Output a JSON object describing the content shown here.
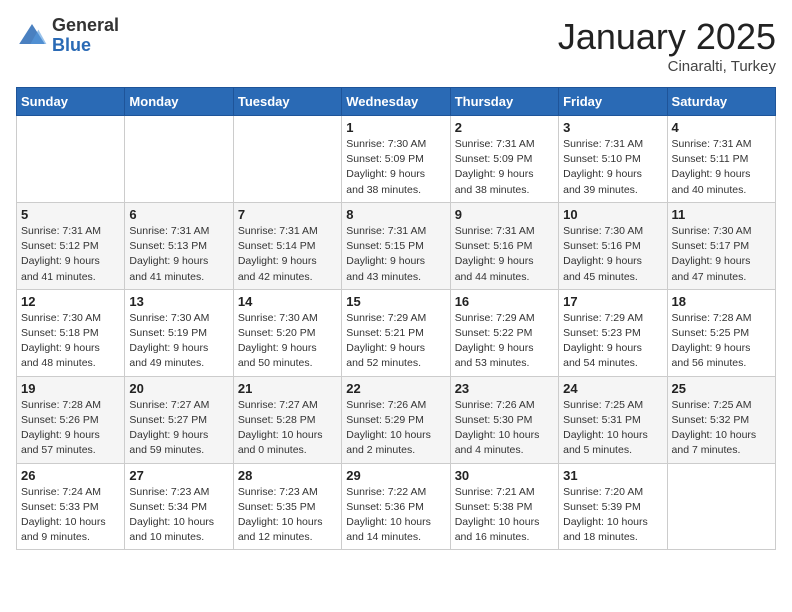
{
  "logo": {
    "general": "General",
    "blue": "Blue"
  },
  "header": {
    "month": "January 2025",
    "location": "Cinaralti, Turkey"
  },
  "weekdays": [
    "Sunday",
    "Monday",
    "Tuesday",
    "Wednesday",
    "Thursday",
    "Friday",
    "Saturday"
  ],
  "weeks": [
    [
      {
        "day": "",
        "info": ""
      },
      {
        "day": "",
        "info": ""
      },
      {
        "day": "",
        "info": ""
      },
      {
        "day": "1",
        "info": "Sunrise: 7:30 AM\nSunset: 5:09 PM\nDaylight: 9 hours\nand 38 minutes."
      },
      {
        "day": "2",
        "info": "Sunrise: 7:31 AM\nSunset: 5:09 PM\nDaylight: 9 hours\nand 38 minutes."
      },
      {
        "day": "3",
        "info": "Sunrise: 7:31 AM\nSunset: 5:10 PM\nDaylight: 9 hours\nand 39 minutes."
      },
      {
        "day": "4",
        "info": "Sunrise: 7:31 AM\nSunset: 5:11 PM\nDaylight: 9 hours\nand 40 minutes."
      }
    ],
    [
      {
        "day": "5",
        "info": "Sunrise: 7:31 AM\nSunset: 5:12 PM\nDaylight: 9 hours\nand 41 minutes."
      },
      {
        "day": "6",
        "info": "Sunrise: 7:31 AM\nSunset: 5:13 PM\nDaylight: 9 hours\nand 41 minutes."
      },
      {
        "day": "7",
        "info": "Sunrise: 7:31 AM\nSunset: 5:14 PM\nDaylight: 9 hours\nand 42 minutes."
      },
      {
        "day": "8",
        "info": "Sunrise: 7:31 AM\nSunset: 5:15 PM\nDaylight: 9 hours\nand 43 minutes."
      },
      {
        "day": "9",
        "info": "Sunrise: 7:31 AM\nSunset: 5:16 PM\nDaylight: 9 hours\nand 44 minutes."
      },
      {
        "day": "10",
        "info": "Sunrise: 7:30 AM\nSunset: 5:16 PM\nDaylight: 9 hours\nand 45 minutes."
      },
      {
        "day": "11",
        "info": "Sunrise: 7:30 AM\nSunset: 5:17 PM\nDaylight: 9 hours\nand 47 minutes."
      }
    ],
    [
      {
        "day": "12",
        "info": "Sunrise: 7:30 AM\nSunset: 5:18 PM\nDaylight: 9 hours\nand 48 minutes."
      },
      {
        "day": "13",
        "info": "Sunrise: 7:30 AM\nSunset: 5:19 PM\nDaylight: 9 hours\nand 49 minutes."
      },
      {
        "day": "14",
        "info": "Sunrise: 7:30 AM\nSunset: 5:20 PM\nDaylight: 9 hours\nand 50 minutes."
      },
      {
        "day": "15",
        "info": "Sunrise: 7:29 AM\nSunset: 5:21 PM\nDaylight: 9 hours\nand 52 minutes."
      },
      {
        "day": "16",
        "info": "Sunrise: 7:29 AM\nSunset: 5:22 PM\nDaylight: 9 hours\nand 53 minutes."
      },
      {
        "day": "17",
        "info": "Sunrise: 7:29 AM\nSunset: 5:23 PM\nDaylight: 9 hours\nand 54 minutes."
      },
      {
        "day": "18",
        "info": "Sunrise: 7:28 AM\nSunset: 5:25 PM\nDaylight: 9 hours\nand 56 minutes."
      }
    ],
    [
      {
        "day": "19",
        "info": "Sunrise: 7:28 AM\nSunset: 5:26 PM\nDaylight: 9 hours\nand 57 minutes."
      },
      {
        "day": "20",
        "info": "Sunrise: 7:27 AM\nSunset: 5:27 PM\nDaylight: 9 hours\nand 59 minutes."
      },
      {
        "day": "21",
        "info": "Sunrise: 7:27 AM\nSunset: 5:28 PM\nDaylight: 10 hours\nand 0 minutes."
      },
      {
        "day": "22",
        "info": "Sunrise: 7:26 AM\nSunset: 5:29 PM\nDaylight: 10 hours\nand 2 minutes."
      },
      {
        "day": "23",
        "info": "Sunrise: 7:26 AM\nSunset: 5:30 PM\nDaylight: 10 hours\nand 4 minutes."
      },
      {
        "day": "24",
        "info": "Sunrise: 7:25 AM\nSunset: 5:31 PM\nDaylight: 10 hours\nand 5 minutes."
      },
      {
        "day": "25",
        "info": "Sunrise: 7:25 AM\nSunset: 5:32 PM\nDaylight: 10 hours\nand 7 minutes."
      }
    ],
    [
      {
        "day": "26",
        "info": "Sunrise: 7:24 AM\nSunset: 5:33 PM\nDaylight: 10 hours\nand 9 minutes."
      },
      {
        "day": "27",
        "info": "Sunrise: 7:23 AM\nSunset: 5:34 PM\nDaylight: 10 hours\nand 10 minutes."
      },
      {
        "day": "28",
        "info": "Sunrise: 7:23 AM\nSunset: 5:35 PM\nDaylight: 10 hours\nand 12 minutes."
      },
      {
        "day": "29",
        "info": "Sunrise: 7:22 AM\nSunset: 5:36 PM\nDaylight: 10 hours\nand 14 minutes."
      },
      {
        "day": "30",
        "info": "Sunrise: 7:21 AM\nSunset: 5:38 PM\nDaylight: 10 hours\nand 16 minutes."
      },
      {
        "day": "31",
        "info": "Sunrise: 7:20 AM\nSunset: 5:39 PM\nDaylight: 10 hours\nand 18 minutes."
      },
      {
        "day": "",
        "info": ""
      }
    ]
  ]
}
